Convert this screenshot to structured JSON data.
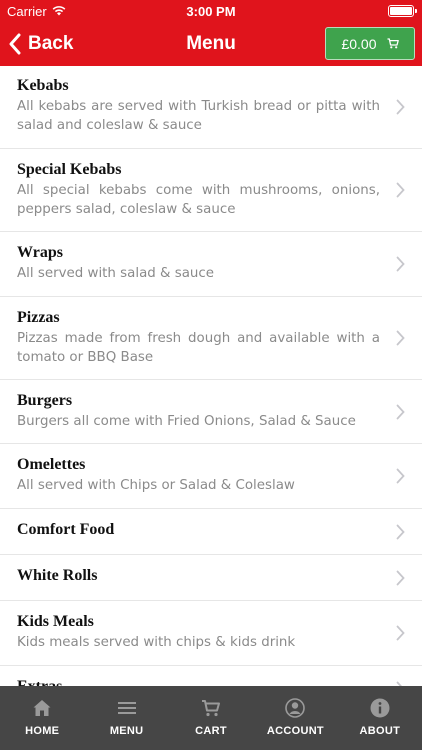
{
  "status_bar": {
    "carrier": "Carrier",
    "time": "3:00 PM"
  },
  "nav": {
    "back_label": "Back",
    "title": "Menu",
    "cart_total": "£0.00"
  },
  "categories": [
    {
      "title": "Kebabs",
      "desc": "All kebabs are served with Turkish bread or pitta with salad and coleslaw & sauce"
    },
    {
      "title": "Special Kebabs",
      "desc": "All special kebabs come with mushrooms, onions, peppers salad, coleslaw & sauce"
    },
    {
      "title": "Wraps",
      "desc": "All served with salad & sauce"
    },
    {
      "title": "Pizzas",
      "desc": "Pizzas made from fresh dough and available with a tomato or BBQ Base"
    },
    {
      "title": "Burgers",
      "desc": "Burgers all come with Fried Onions, Salad & Sauce"
    },
    {
      "title": "Omelettes",
      "desc": "All served with Chips or Salad & Coleslaw"
    },
    {
      "title": "Comfort Food",
      "desc": ""
    },
    {
      "title": "White Rolls",
      "desc": ""
    },
    {
      "title": "Kids Meals",
      "desc": "Kids meals served with chips & kids drink"
    },
    {
      "title": "Extras",
      "desc": ""
    }
  ],
  "tabs": [
    {
      "label": "HOME",
      "icon": "home-icon"
    },
    {
      "label": "MENU",
      "icon": "menu-icon"
    },
    {
      "label": "CART",
      "icon": "cart-icon"
    },
    {
      "label": "ACCOUNT",
      "icon": "account-icon"
    },
    {
      "label": "ABOUT",
      "icon": "info-icon"
    }
  ],
  "colors": {
    "brand_red": "#e0141c",
    "cart_green": "#3fa34d",
    "tabbar": "#464646"
  }
}
